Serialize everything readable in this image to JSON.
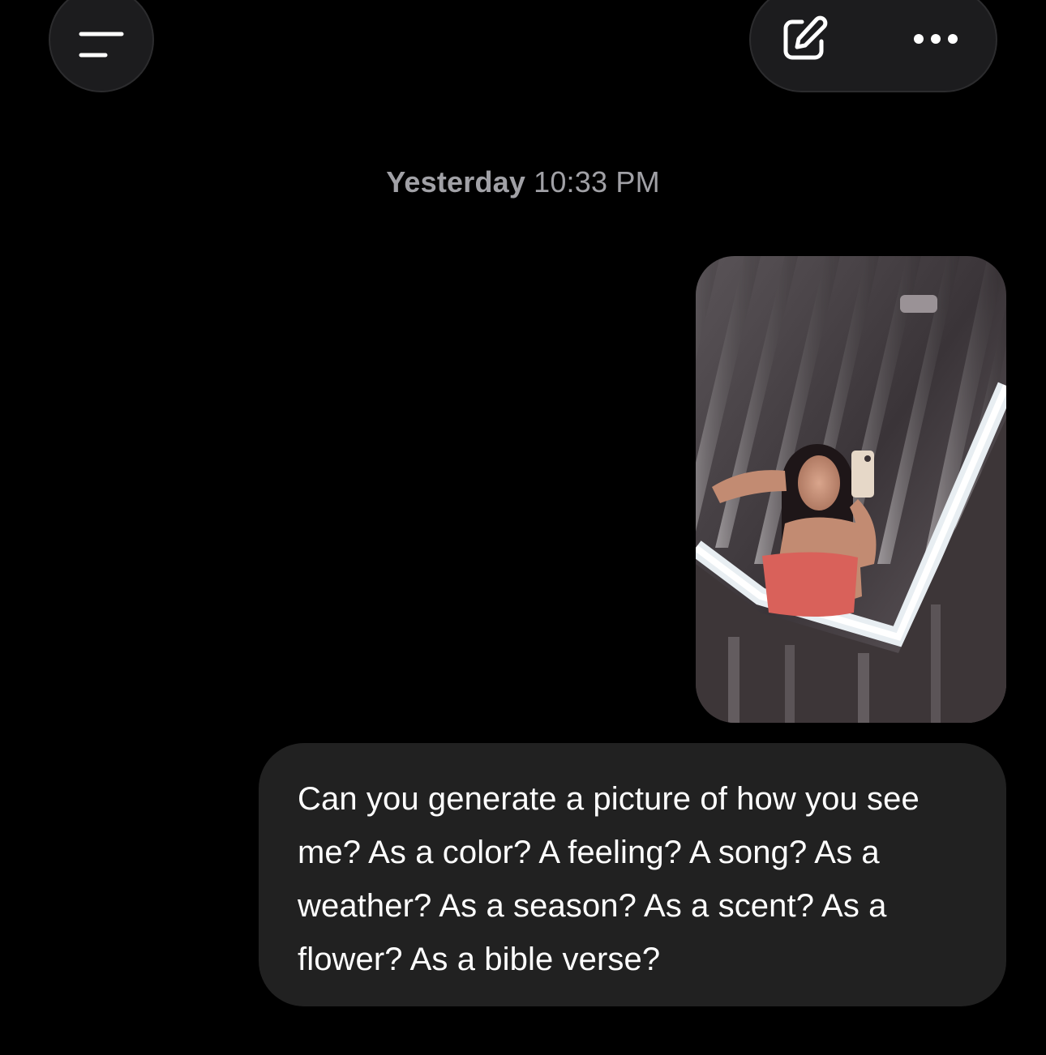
{
  "header": {
    "menu_icon": "hamburger-menu-icon",
    "compose_icon": "compose-edit-icon",
    "more_icon": "more-horizontal-icon"
  },
  "timestamp": {
    "day": "Yesterday",
    "time": "10:33 PM"
  },
  "conversation": {
    "image_message": {
      "type": "photo",
      "description_icon": "photo-attachment"
    },
    "text_message": "Can you generate a picture of how you see me? As a color? A feeling? A song? As a weather? As a season? As a scent? As a flower? As a bible verse?"
  },
  "colors": {
    "background": "#000000",
    "bubble": "#212121",
    "button_bg": "#1c1c1e",
    "timestamp": "#a1a1a6"
  }
}
